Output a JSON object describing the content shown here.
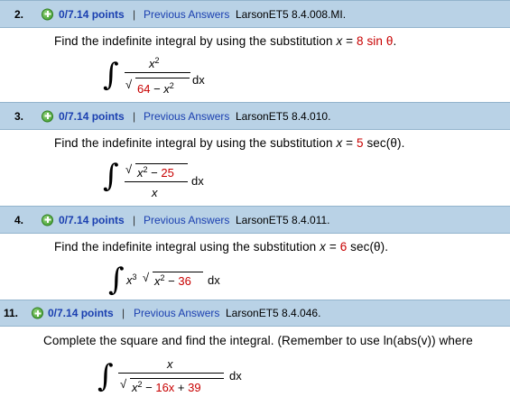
{
  "questions": [
    {
      "number": "2.",
      "score": "0/7.14 points",
      "separator": "|",
      "previous": "Previous Answers",
      "ref": "LarsonET5 8.4.008.MI.",
      "prompt_pre": "Find the indefinite integral by using the substitution ",
      "prompt_var": "x",
      "prompt_eq": " = ",
      "prompt_val": "8 sin θ",
      "prompt_post": "."
    },
    {
      "number": "3.",
      "score": "0/7.14 points",
      "separator": "|",
      "previous": "Previous Answers",
      "ref": "LarsonET5 8.4.010.",
      "prompt_pre": "Find the indefinite integral by using the substitution ",
      "prompt_var": "x",
      "prompt_eq": " = ",
      "prompt_val": "5",
      "prompt_post": " sec(θ)."
    },
    {
      "number": "4.",
      "score": "0/7.14 points",
      "separator": "|",
      "previous": "Previous Answers",
      "ref": "LarsonET5 8.4.011.",
      "prompt_pre": "Find the indefinite integral using the substitution ",
      "prompt_var": "x",
      "prompt_eq": " = ",
      "prompt_val": "6",
      "prompt_post": " sec(θ)."
    },
    {
      "number": "11.",
      "score": "0/7.14 points",
      "separator": "|",
      "previous": "Previous Answers",
      "ref": "LarsonET5 8.4.046.",
      "prompt_pre": "Complete the square and find the integral. (Remember to use ln(abs(v)) where",
      "prompt_var": "",
      "prompt_eq": "",
      "prompt_val": "",
      "prompt_post": ""
    }
  ],
  "math": {
    "integral_sign": "∫",
    "dx": "dx",
    "q2": {
      "num": "x",
      "num_exp": "2",
      "den_a": "64",
      "den_op": " − ",
      "den_b": "x",
      "den_b_exp": "2"
    },
    "q3": {
      "num_a": "x",
      "num_a_exp": "2",
      "num_op": " − ",
      "num_b": "25",
      "den": "x"
    },
    "q4": {
      "lead": "x",
      "lead_exp": "3",
      "rad_a": "x",
      "rad_a_exp": "2",
      "rad_op": " − ",
      "rad_b": "36"
    },
    "q11": {
      "num": "x",
      "rad_a": "x",
      "rad_a_exp": "2",
      "rad_op1": " − ",
      "rad_b": "16x",
      "rad_op2": " + ",
      "rad_c": "39"
    }
  },
  "colors": {
    "header_bg": "#b9d2e6",
    "link": "#1a3fb0",
    "red_value": "#c80000",
    "plus_icon": "#3a9a27"
  }
}
